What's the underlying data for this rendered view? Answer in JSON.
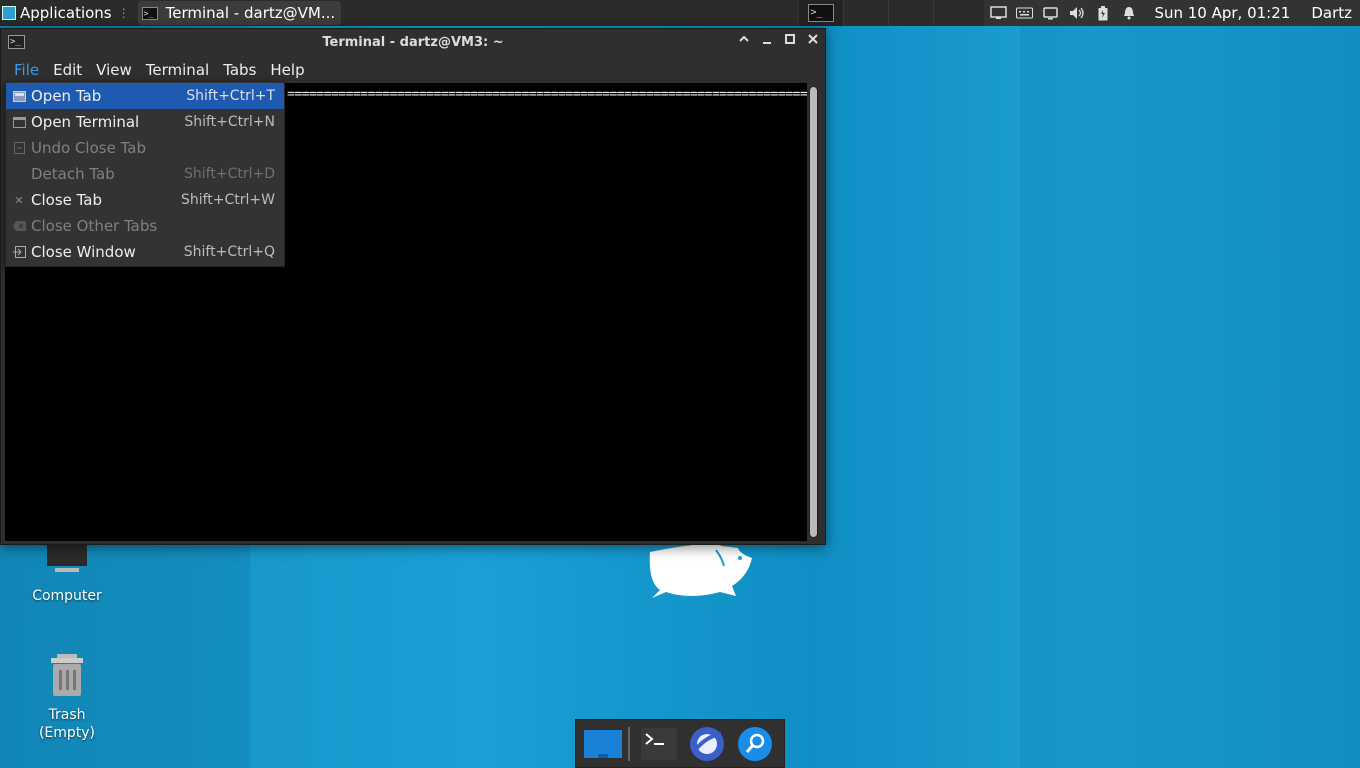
{
  "top_panel": {
    "applications_label": "Applications",
    "task_label": "Terminal - dartz@VM...",
    "clock": "Sun 10 Apr, 01:21",
    "user": "Dartz",
    "tray_icons": [
      "network-icon",
      "keyboard-icon",
      "display-icon",
      "volume-icon",
      "battery-icon",
      "notification-bell-icon"
    ]
  },
  "desktop": {
    "icons": [
      {
        "label": "Computer"
      },
      {
        "label": "Trash\n(Empty)"
      }
    ]
  },
  "terminal": {
    "title": "Terminal - dartz@VM3: ~",
    "menu": [
      "File",
      "Edit",
      "View",
      "Terminal",
      "Tabs",
      "Help"
    ],
    "line": "=============================================================================="
  },
  "file_menu": {
    "items": [
      {
        "label": "Open Tab",
        "accel": "Shift+Ctrl+T",
        "enabled": true,
        "highlighted": true
      },
      {
        "label": "Open Terminal",
        "accel": "Shift+Ctrl+N",
        "enabled": true
      },
      {
        "label": "Undo Close Tab",
        "accel": "",
        "enabled": false
      },
      {
        "label": "Detach Tab",
        "accel": "Shift+Ctrl+D",
        "enabled": false
      },
      {
        "label": "Close Tab",
        "accel": "Shift+Ctrl+W",
        "enabled": true
      },
      {
        "label": "Close Other Tabs",
        "accel": "",
        "enabled": false
      },
      {
        "label": "Close Window",
        "accel": "Shift+Ctrl+Q",
        "enabled": true
      }
    ]
  },
  "dock": {
    "items": [
      "show-desktop-icon",
      "terminal-icon",
      "web-browser-icon",
      "app-finder-icon"
    ]
  },
  "colors": {
    "accent": "#1e5bb0",
    "desktop": "#1aa0d4"
  }
}
